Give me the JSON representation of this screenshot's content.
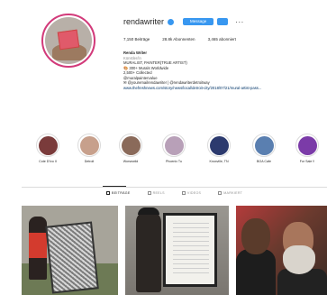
{
  "profile": {
    "username": "rendawriter",
    "message_button": "Message",
    "more": "···",
    "stats": {
      "posts": "7,150 Beiträge",
      "followers": "28.8k Abonnenten",
      "following": "3,465 abonniert"
    },
    "bio": {
      "name": "Renda Writer",
      "category": "Künstler/in",
      "line1": "MURALIST, PAINTER(TRUE ARTIST)",
      "line2": "🎨 300+ Murals Worldwide",
      "line3": "2,500+ Collected",
      "line4": "@muralpaintervalue",
      "line5": "✉ @youremailrendawriter | @rendawriterdetroitway",
      "link": "www.thefreshnews.com/story/news/local/detroit-city/2018/07/21/mural-artist-pass..."
    },
    "colors": {
      "accent": "#3897f0",
      "ring": "#d23a7a"
    }
  },
  "highlights": [
    {
      "label": "Cote D'Ivo II",
      "color": "#7a3b3b"
    },
    {
      "label": "Detroit",
      "color": "#c7a08c"
    },
    {
      "label": "Worsewild",
      "color": "#8a6a5a"
    },
    {
      "label": "Phoenix Tu",
      "color": "#b8a0b8"
    },
    {
      "label": "Knoxville, TN",
      "color": "#2c3a6e"
    },
    {
      "label": "BOA Cafe",
      "color": "#5a7fb0"
    },
    {
      "label": "For Sale !!",
      "color": "#7b3ba8"
    }
  ],
  "tabs": {
    "posts": "BEITRÄGE",
    "reels": "REELS",
    "videos": "VIDEOS",
    "tagged": "MARKIERT"
  }
}
